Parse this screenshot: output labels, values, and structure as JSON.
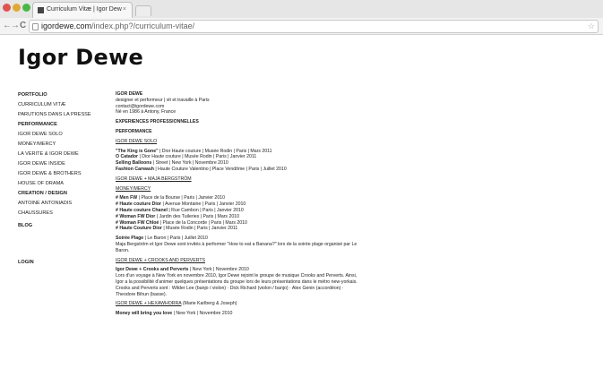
{
  "browser": {
    "tab_title": "Curriculum Vitæ | Igor Dew",
    "tab_close": "×",
    "back": "←",
    "forward": "→",
    "reload": "C",
    "url_host": "igordewe.com",
    "url_path": "/index.php?/curriculum-vitae/",
    "star": "☆"
  },
  "site": {
    "title": "Igor Dewe"
  },
  "sidebar": {
    "portfolio": "PORTFOLIO",
    "cv": "CURRICULUM VITÆ",
    "parutions": "PARUTIONS DANS LA PRESSE",
    "performance": "PERFORMANCE",
    "solo": "IGOR DEWE SOLO",
    "money": "MONEY/MERCY",
    "verite": "LA VERITE & IGOR DEWE",
    "inside": "IGOR DEWE INSIDE",
    "brothers": "IGOR DEWE & BROTHERS",
    "drama": "HOUSE OF DRAMA",
    "creation": "CREATION / DESIGN",
    "antoine": "ANTOINE ANTONIADIS",
    "chaussures": "CHAUSSURES",
    "blog": "BLOG",
    "login": "LOGIN"
  },
  "main": {
    "name": "IGOR DEWE",
    "bio1": "designer et performeur | vit et travaille à Paris",
    "email": "contact@igordewe.com",
    "bio3": "Né en 1986 à Antony, France",
    "exp": "EXPERIENCES PROFESSIONNELLES",
    "perf": "PERFORMANCE",
    "solo_link": "IGOR DEWE SOLO",
    "solo1a": "\"The King is Gone\"",
    "solo1b": " | Dior Haute couture | Musée Rodin | Paris | Mars 2011",
    "solo2a": "O Catador",
    "solo2b": " | Dior Haute couture | Musée Rodin | Paris | Janvier 2011",
    "solo3a": "Selling Balloons",
    "solo3b": " | Street | New York | Novembre 2010",
    "solo4a": "Fashion Carwash",
    "solo4b": " | Haute Couture Valentino | Place Vendôme | Paris | Juillet 2010",
    "maja_link": "IGOR DEWE + MAJA BERGSTRÖM",
    "money_link": "MONEY/MERCY",
    "m1a": "# Men FW",
    "m1b": " | Place de la Bourse | Paris | Janvier 2010",
    "m2a": "# Haute couture Dior",
    "m2b": " | Avenue Montaine | Paris | Janvier 2010",
    "m3a": "# Haute couture Chanel",
    "m3b": " | Rue Cambon | Paris | Janvier 2010",
    "m4a": "# Woman FW Dior",
    "m4b": " | Jardin des Tuileries | Paris | Mars 2010",
    "m5a": "# Woman FW Chloé",
    "m5b": " | Place de la Concorde | Paris | Mars 2010",
    "m6a": "# Haute Couture Dior",
    "m6b": " | Musée Rodin | Paris | Janvier 2011",
    "soiree_a": "Soirée Plage",
    "soiree_b": " | Le Baron | Paris | Juillet 2010",
    "soiree_desc": "Maja Bergström et Igor Dewe sont invités à performer \"How to eat a Banana?\" lors de la soirée plage organisé par Le Baron.",
    "crooks_link": "IGOR DEWE + CROOKS AND PERVERTS",
    "crooks_a": "Igor Dewe + Crooks and Perverts",
    "crooks_b": " | New York | Novembre 2010",
    "crooks_desc": "Lors d'un voyage à New York en novembre 2010, Igor Dewe rejoint le groupe de musique Crooks and Perverts. Ainsi, Igor a la possibilité d'animer quelques présentations du groupe lors de leurs présentations dans le métro new-yorkais.",
    "crooks_members": "Crooks and Perverts sont : Wilder Lee (banjo / violon) · Dick Richard (violon / banjo) · Alex Genin (accordéon) · Theodore Bihun (basse).",
    "hexa_link": "IGOR DEWE + HEXAWHORRA",
    "hexa_rest": " (Marie Karlberg & Joseph)",
    "money2_a": "Money will bring you love",
    "money2_b": " | New York | Novembre 2010"
  }
}
